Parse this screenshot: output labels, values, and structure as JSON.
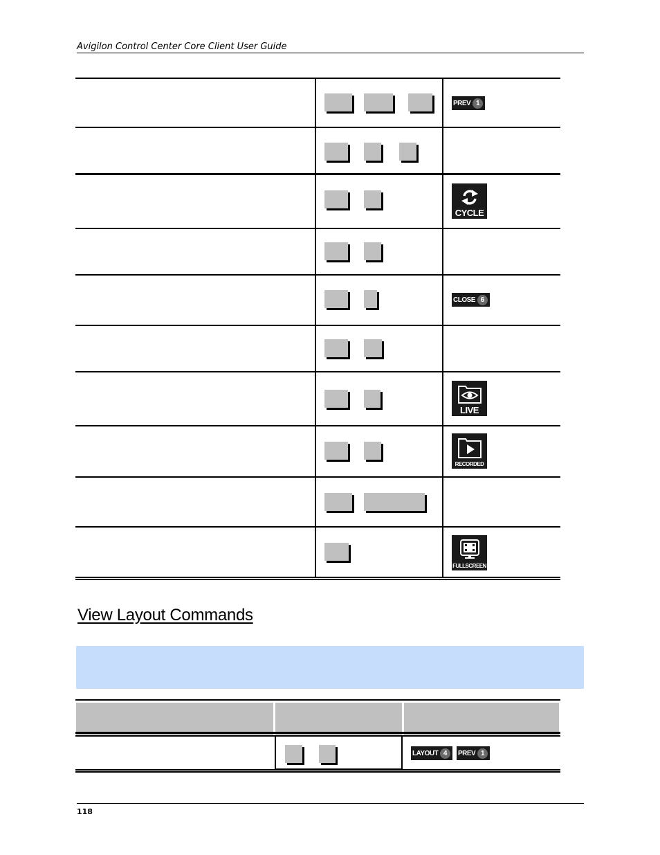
{
  "header": {
    "title": "Avigilon Control Center Core Client User Guide"
  },
  "table1": {
    "rows": [
      {
        "description": "",
        "key_count": 3,
        "icon": {
          "type": "pill",
          "name": "prev-icon",
          "label": "PREV",
          "number": "1"
        }
      },
      {
        "description": "",
        "key_count": 3,
        "icon": null
      },
      {
        "description": "",
        "key_count": 2,
        "icon": {
          "type": "tile",
          "name": "cycle-icon",
          "label": "CYCLE"
        }
      },
      {
        "description": "",
        "key_count": 2,
        "icon": null
      },
      {
        "description": "",
        "key_count": 2,
        "icon": {
          "type": "pill",
          "name": "close-icon",
          "label": "CLOSE",
          "number": "6"
        }
      },
      {
        "description": "",
        "key_count": 2,
        "icon": null
      },
      {
        "description": "",
        "key_count": 2,
        "icon": {
          "type": "tile",
          "name": "live-icon",
          "label": "LIVE"
        }
      },
      {
        "description": "",
        "key_count": 2,
        "icon": {
          "type": "tile",
          "name": "recorded-icon",
          "label": "RECORDED"
        }
      },
      {
        "description": "",
        "key_count": 2,
        "icon": null
      },
      {
        "description": "",
        "key_count": 1,
        "icon": {
          "type": "tile",
          "name": "fullscreen-icon",
          "label": "FULLSCREEN"
        }
      }
    ]
  },
  "section": {
    "title": "View Layout Commands"
  },
  "note": {
    "text": ""
  },
  "table2": {
    "headers": [
      "",
      "",
      ""
    ],
    "rows": [
      {
        "description": "",
        "key_count": 2,
        "icons": [
          {
            "name": "layout-icon",
            "label": "LAYOUT",
            "number": "4"
          },
          {
            "name": "prev-icon",
            "label": "PREV",
            "number": "1"
          }
        ]
      }
    ]
  },
  "footer": {
    "page_number": "118"
  }
}
